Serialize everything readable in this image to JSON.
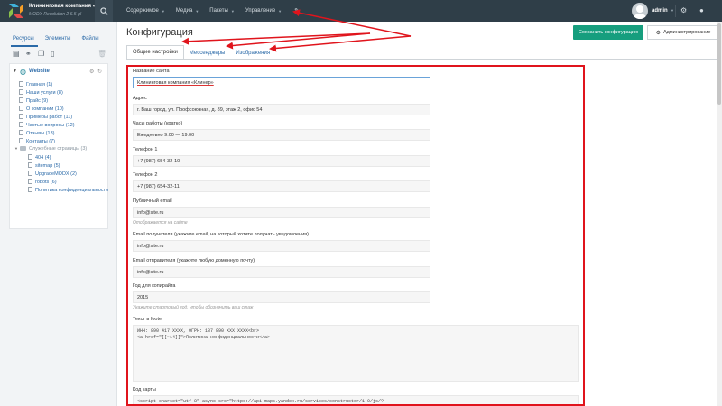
{
  "header": {
    "site_name": "Клининговая компания «К...",
    "version": "MODX Revolution 2.6.5-pl",
    "nav": [
      {
        "label": "Содержимое"
      },
      {
        "label": "Медиа"
      },
      {
        "label": "Пакеты"
      },
      {
        "label": "Управление"
      }
    ],
    "user": "admin"
  },
  "sidebar": {
    "tabs": [
      "Ресурсы",
      "Элементы",
      "Файлы"
    ],
    "root": "Website",
    "nodes": [
      "Главная (1)",
      "Наши услуги (8)",
      "Прайс (9)",
      "О компании (10)",
      "Примеры работ (11)",
      "Частые вопросы (12)",
      "Отзывы (13)",
      "Контакты (7)",
      "Служебные страницы (3)",
      "404 (4)",
      "sitemap (5)",
      "UpgradeMODX (2)",
      "robots (6)",
      "Политика конфиденциальности"
    ]
  },
  "main": {
    "title": "Конфигурация",
    "save_label": "Сохранить конфигурацию",
    "admin_label": "Администрирование",
    "tabs": [
      "Общие настройки",
      "Мессенджеры",
      "Изображения"
    ],
    "fields": [
      {
        "label": "Название сайта",
        "value": "Клининговая компания «Клинер»"
      },
      {
        "label": "Адрес",
        "value": "г. Ваш город, ул. Профсоюзная, д. 89, этаж 2, офис 54"
      },
      {
        "label": "Часы работы (кратко)",
        "value": "Ежедневно 9:00 — 19:00"
      },
      {
        "label": "Телефон 1",
        "value": "+7 (987) 654-32-10"
      },
      {
        "label": "Телефон 2",
        "value": "+7 (987) 654-32-11"
      },
      {
        "label": "Публичный email",
        "value": "info@site.ru",
        "hint": "Отображается на сайте"
      },
      {
        "label": "Email получателя (укажите email, на который хотите получать уведомления)",
        "value": "info@site.ru"
      },
      {
        "label": "Email отправителя (укажите любую доменную почту)",
        "value": "info@site.ru"
      },
      {
        "label": "Год для копирайта",
        "value": "2015",
        "hint": "Укажите стартовый год, чтобы обозначить ваш стаж"
      }
    ],
    "footer_label": "Текст в footer",
    "footer_text": "ИНН: 890 417 XXXX, ОГРН: 137 890 XXX XXXX<br>\n<a href=\"[[~14]]\">Политика конфиденциальности</a>",
    "map_label": "Код карты",
    "map_text": "<script charset=\"utf-8\" async src=\"https://api-maps.yandex.ru/services/constructor/1.0/js/?"
  },
  "colors": {
    "topbar": "#2f3e48",
    "accent": "#169e7e",
    "highlight": "#e0141c",
    "link": "#2b6aa8"
  }
}
